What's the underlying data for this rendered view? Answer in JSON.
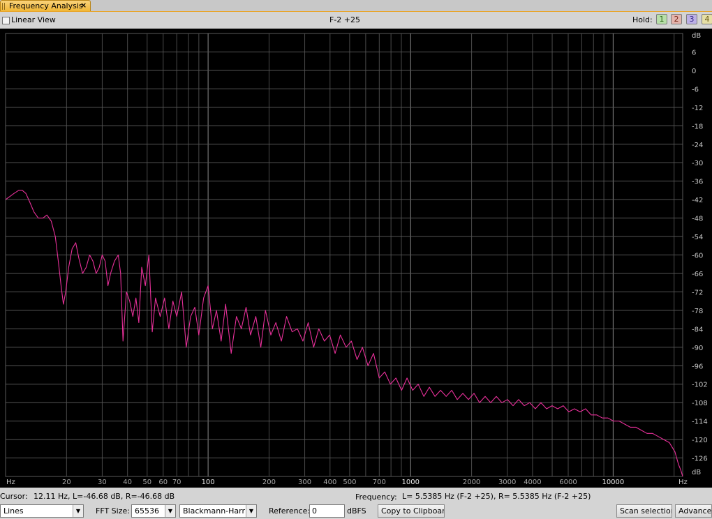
{
  "tab": {
    "title": "Frequency Analysis",
    "close": "×"
  },
  "toolbar": {
    "linear_view_label": "Linear View",
    "channel_label": "F-2 +25",
    "hold_label": "Hold:",
    "hold_buttons": [
      "1",
      "2",
      "3",
      "4"
    ],
    "hold_colors": [
      "#b7dfa8",
      "#e4b4ac",
      "#bcb0e6",
      "#e6dfa6"
    ]
  },
  "status": {
    "cursor_label": "Cursor:",
    "cursor_value": "12.11 Hz, L=-46.68 dB, R=-46.68 dB",
    "frequency_label": "Frequency:",
    "frequency_value": "L= 5.5385 Hz (F-2 +25), R= 5.5385 Hz (F-2 +25)"
  },
  "controls": {
    "plot_type": "Lines",
    "fft_label": "FFT Size:",
    "fft_size": "65536",
    "window": "Blackmann-Harris",
    "reference_label": "Reference:",
    "reference_value": "0",
    "reference_unit": "dBFS",
    "copy_label": "Copy to Clipboard",
    "scan_label": "Scan selection",
    "advanced_label": "Advanced"
  },
  "chart_data": {
    "type": "line",
    "x_scale": "log",
    "xlim": [
      10,
      22050
    ],
    "ylim": [
      -132,
      12
    ],
    "x_unit_label": "Hz",
    "y_unit_label": "dB",
    "x_ticks": [
      {
        "v": 20,
        "label": "20"
      },
      {
        "v": 30,
        "label": "30"
      },
      {
        "v": 40,
        "label": "40"
      },
      {
        "v": 50,
        "label": "50"
      },
      {
        "v": 60,
        "label": "60"
      },
      {
        "v": 70,
        "label": "70"
      },
      {
        "v": 100,
        "label": "100"
      },
      {
        "v": 200,
        "label": "200"
      },
      {
        "v": 300,
        "label": "300"
      },
      {
        "v": 400,
        "label": "400"
      },
      {
        "v": 500,
        "label": "500"
      },
      {
        "v": 700,
        "label": "700"
      },
      {
        "v": 1000,
        "label": "1000"
      },
      {
        "v": 2000,
        "label": "2000"
      },
      {
        "v": 3000,
        "label": "3000"
      },
      {
        "v": 4000,
        "label": "4000"
      },
      {
        "v": 6000,
        "label": "6000"
      },
      {
        "v": 10000,
        "label": "10000"
      }
    ],
    "y_ticks": [
      6,
      0,
      -6,
      -12,
      -18,
      -24,
      -30,
      -36,
      -42,
      -48,
      -54,
      -60,
      -66,
      -72,
      -78,
      -84,
      -90,
      -96,
      -102,
      -108,
      -114,
      -120,
      -126
    ],
    "grid": true,
    "series": [
      {
        "color": "#e8309a",
        "points": [
          [
            10,
            -42
          ],
          [
            10.5,
            -41
          ],
          [
            11,
            -40
          ],
          [
            11.6,
            -39
          ],
          [
            12.1,
            -39
          ],
          [
            12.6,
            -40
          ],
          [
            13.2,
            -43
          ],
          [
            13.8,
            -46
          ],
          [
            14.5,
            -48
          ],
          [
            15.3,
            -48
          ],
          [
            16.0,
            -47
          ],
          [
            16.8,
            -49
          ],
          [
            17.6,
            -54
          ],
          [
            18.2,
            -62
          ],
          [
            18.8,
            -70
          ],
          [
            19.3,
            -76
          ],
          [
            19.8,
            -72
          ],
          [
            20.5,
            -64
          ],
          [
            21.3,
            -58
          ],
          [
            22.2,
            -56
          ],
          [
            23.0,
            -61
          ],
          [
            24.0,
            -66
          ],
          [
            25.0,
            -64
          ],
          [
            26.0,
            -60
          ],
          [
            27.0,
            -62
          ],
          [
            28.0,
            -66
          ],
          [
            29.0,
            -64
          ],
          [
            30.0,
            -60
          ],
          [
            31.0,
            -62
          ],
          [
            32.0,
            -70
          ],
          [
            33.0,
            -66
          ],
          [
            34.5,
            -62
          ],
          [
            36.0,
            -60
          ],
          [
            37.0,
            -66
          ],
          [
            38.0,
            -88
          ],
          [
            39.5,
            -72
          ],
          [
            41.0,
            -75
          ],
          [
            42.5,
            -80
          ],
          [
            44.0,
            -74
          ],
          [
            45.5,
            -82
          ],
          [
            47.0,
            -64
          ],
          [
            49.0,
            -70
          ],
          [
            51.0,
            -60
          ],
          [
            53.0,
            -85
          ],
          [
            55.0,
            -74
          ],
          [
            58.0,
            -80
          ],
          [
            61.0,
            -74
          ],
          [
            64.0,
            -84
          ],
          [
            67.0,
            -75
          ],
          [
            70.0,
            -80
          ],
          [
            74.0,
            -72
          ],
          [
            78.0,
            -90
          ],
          [
            82.0,
            -80
          ],
          [
            86.0,
            -77
          ],
          [
            90.0,
            -86
          ],
          [
            95.0,
            -74
          ],
          [
            100.0,
            -70
          ],
          [
            105.0,
            -84
          ],
          [
            110.0,
            -78
          ],
          [
            116.0,
            -88
          ],
          [
            122.0,
            -76
          ],
          [
            130.0,
            -92
          ],
          [
            138.0,
            -80
          ],
          [
            146.0,
            -84
          ],
          [
            154.0,
            -77
          ],
          [
            162.0,
            -86
          ],
          [
            172.0,
            -80
          ],
          [
            182.0,
            -90
          ],
          [
            192.0,
            -78
          ],
          [
            204.0,
            -86
          ],
          [
            216.0,
            -82
          ],
          [
            230.0,
            -88
          ],
          [
            244.0,
            -80
          ],
          [
            260.0,
            -85
          ],
          [
            276.0,
            -84
          ],
          [
            294.0,
            -88
          ],
          [
            312.0,
            -82
          ],
          [
            332.0,
            -90
          ],
          [
            352.0,
            -84
          ],
          [
            375.0,
            -88
          ],
          [
            398.0,
            -86
          ],
          [
            424.0,
            -92
          ],
          [
            450.0,
            -86
          ],
          [
            480.0,
            -90
          ],
          [
            510.0,
            -88
          ],
          [
            544.0,
            -94
          ],
          [
            578.0,
            -90
          ],
          [
            616.0,
            -96
          ],
          [
            656.0,
            -92
          ],
          [
            700.0,
            -100
          ],
          [
            745.0,
            -98
          ],
          [
            795.0,
            -102
          ],
          [
            846.0,
            -100
          ],
          [
            902.0,
            -104
          ],
          [
            960.0,
            -100
          ],
          [
            1024.0,
            -104
          ],
          [
            1090.0,
            -102
          ],
          [
            1162.0,
            -106
          ],
          [
            1238.0,
            -103
          ],
          [
            1320.0,
            -106
          ],
          [
            1406.0,
            -104
          ],
          [
            1498.0,
            -106
          ],
          [
            1596.0,
            -104
          ],
          [
            1700.0,
            -107
          ],
          [
            1812.0,
            -105
          ],
          [
            1930.0,
            -107
          ],
          [
            2056.0,
            -105
          ],
          [
            2190.0,
            -108
          ],
          [
            2334.0,
            -106
          ],
          [
            2486.0,
            -108
          ],
          [
            2650.0,
            -106
          ],
          [
            2822.0,
            -108
          ],
          [
            3008.0,
            -107
          ],
          [
            3204.0,
            -109
          ],
          [
            3414.0,
            -107
          ],
          [
            3638.0,
            -109
          ],
          [
            3876.0,
            -108
          ],
          [
            4130.0,
            -110
          ],
          [
            4400.0,
            -108
          ],
          [
            4690.0,
            -110
          ],
          [
            4996.0,
            -109
          ],
          [
            5324.0,
            -110
          ],
          [
            5672.0,
            -109
          ],
          [
            6044.0,
            -111
          ],
          [
            6440.0,
            -110
          ],
          [
            6862.0,
            -111
          ],
          [
            7312.0,
            -110
          ],
          [
            7790.0,
            -112
          ],
          [
            8300.0,
            -112
          ],
          [
            8846.0,
            -113
          ],
          [
            9426.0,
            -113
          ],
          [
            10044.0,
            -114
          ],
          [
            10702.0,
            -114
          ],
          [
            11404.0,
            -115
          ],
          [
            12150.0,
            -116
          ],
          [
            12946.0,
            -116
          ],
          [
            13794.0,
            -117
          ],
          [
            14698.0,
            -118
          ],
          [
            15660.0,
            -118
          ],
          [
            16688.0,
            -119
          ],
          [
            17780.0,
            -120
          ],
          [
            18946.0,
            -121
          ],
          [
            20188.0,
            -124
          ],
          [
            21000.0,
            -128
          ],
          [
            21600.0,
            -130
          ],
          [
            22050.0,
            -132
          ]
        ]
      }
    ]
  }
}
